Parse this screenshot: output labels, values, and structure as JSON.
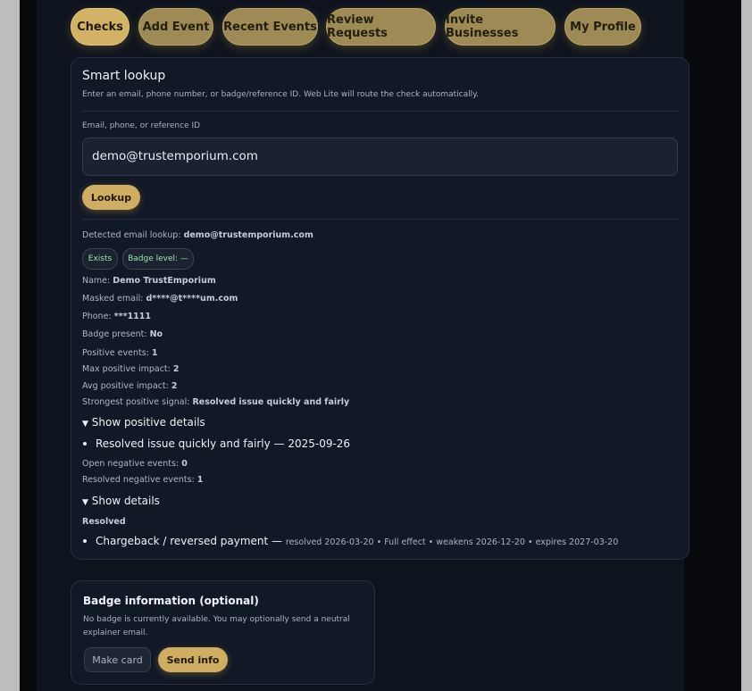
{
  "tabs": [
    {
      "label": "Checks",
      "active": true
    },
    {
      "label": "Add Event",
      "active": false
    },
    {
      "label": "Recent Events",
      "active": false
    },
    {
      "label": "Review Requests",
      "active": false
    },
    {
      "label": "Invite Businesses",
      "active": false
    },
    {
      "label": "My Profile",
      "active": false
    }
  ],
  "lookup": {
    "title": "Smart lookup",
    "description": "Enter an email, phone number, or badge/reference ID. Web Lite will route the check automatically.",
    "field_label": "Email, phone, or reference ID",
    "field_value": "demo@trustemporium.com",
    "button_label": "Lookup"
  },
  "result": {
    "detected_label": "Detected email lookup:",
    "detected_value": "demo@trustemporium.com",
    "pill_exists": "Exists",
    "pill_badge": "Badge level: —",
    "name_label": "Name:",
    "name_value": "Demo TrustEmporium",
    "masked_label": "Masked email:",
    "masked_value": "d****@t****um.com",
    "phone_label": "Phone:",
    "phone_value": "***1111",
    "badge_present_label": "Badge present:",
    "badge_present_value": "No",
    "positive_events_label": "Positive events:",
    "positive_events_value": "1",
    "max_impact_label": "Max positive impact:",
    "max_impact_value": "2",
    "avg_impact_label": "Avg positive impact:",
    "avg_impact_value": "2",
    "strongest_label": "Strongest positive signal:",
    "strongest_value": "Resolved issue quickly and fairly",
    "positive_toggle": "Show positive details",
    "positive_item": "Resolved issue quickly and fairly — 2025-09-26",
    "open_negative_label": "Open negative events:",
    "open_negative_value": "0",
    "resolved_negative_label": "Resolved negative events:",
    "resolved_negative_value": "1",
    "details_toggle": "Show details",
    "resolved_heading": "Resolved",
    "negative_item_title": "Chargeback / reversed payment —",
    "negative_item_meta": "resolved 2026-03-20 • Full effect • weakens 2026-12-20 • expires 2027-03-20"
  },
  "badge_info": {
    "title": "Badge information (optional)",
    "text_line1": "No badge is currently available. You may optionally send a neutral",
    "text_line2": "explainer email.",
    "make_card_label": "Make card",
    "send_info_label": "Send info"
  },
  "colors": {
    "gold_active": "#d2b264",
    "gold_tab": "#9d8a55",
    "background": "#0e141e",
    "pill_text": "#9fe3b0"
  }
}
